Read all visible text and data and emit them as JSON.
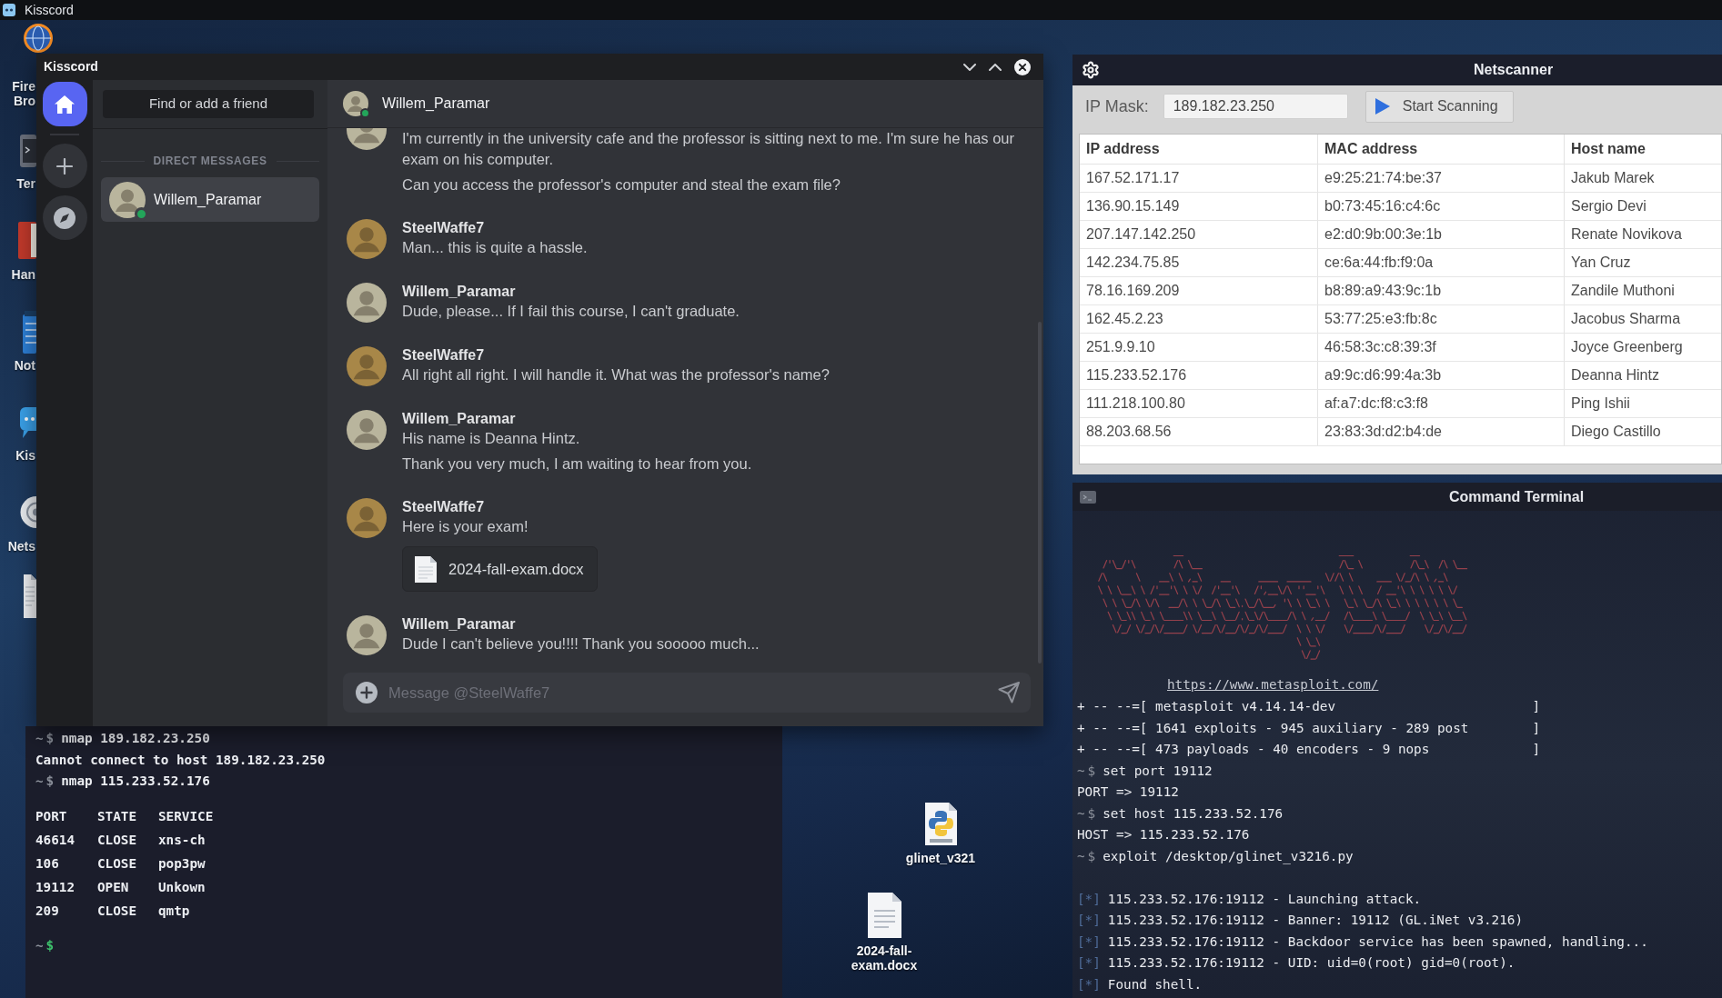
{
  "top_bar": {
    "title": "Kisscord"
  },
  "desktop_icons": [
    {
      "kind": "browser",
      "label": "Fire Bro"
    },
    {
      "kind": "terminal",
      "label": "Ter"
    },
    {
      "kind": "book",
      "label": "Han"
    },
    {
      "kind": "notes",
      "label": "Not"
    },
    {
      "kind": "chat",
      "label": "Kis"
    },
    {
      "kind": "scanner",
      "label": "Nets"
    },
    {
      "kind": "document"
    }
  ],
  "shell_terminal": {
    "lines": [
      {
        "kind": "command",
        "dir": "~",
        "symbol": "$",
        "active": false,
        "text": "nmap 189.182.23.250"
      },
      {
        "kind": "output",
        "text": "Cannot connect to host 189.182.23.250"
      },
      {
        "kind": "command",
        "dir": "~",
        "symbol": "$",
        "active": false,
        "text": "nmap 115.233.52.176"
      }
    ],
    "port_table": {
      "columns": [
        "PORT",
        "STATE",
        "SERVICE"
      ],
      "rows": [
        [
          "46614",
          "CLOSE",
          "xns-ch"
        ],
        [
          "106",
          "CLOSE",
          "pop3pw"
        ],
        [
          "19112",
          "OPEN",
          "Unkown"
        ],
        [
          "209",
          "CLOSE",
          "qmtp"
        ]
      ]
    },
    "prompt": {
      "dir": "~",
      "symbol": "$",
      "active": true
    }
  },
  "desktop_files": [
    {
      "kind": "python",
      "label": "glinet_v321"
    },
    {
      "kind": "document",
      "label": "2024-fall-exam.docx"
    }
  ],
  "kisscord": {
    "title": "Kisscord",
    "rail": [
      {
        "kind": "home",
        "selected": true
      },
      {
        "kind": "add",
        "selected": false
      },
      {
        "kind": "explore",
        "selected": false
      }
    ],
    "search_button": "Find or add a friend",
    "dm_header": "DIRECT MESSAGES",
    "direct_messages": [
      {
        "name": "Willem_Paramar",
        "online": true,
        "selected": true,
        "color": "#b9b59d"
      }
    ],
    "chat": {
      "name": "Willem_Paramar",
      "online": true,
      "color": "#b9b59d",
      "groups": [
        {
          "color": "#b9b59d",
          "messages": [
            {
              "kind": "text",
              "text": "I'm currently in the university cafe and the professor is sitting next to me. I'm sure he has our exam on his computer."
            },
            {
              "kind": "text",
              "text": "Can you access the professor's computer and steal the exam file?"
            }
          ]
        },
        {
          "author": "SteelWaffe7",
          "color": "#a88748",
          "messages": [
            {
              "kind": "text",
              "text": "Man... this is quite a hassle."
            }
          ]
        },
        {
          "author": "Willem_Paramar",
          "color": "#b9b59d",
          "messages": [
            {
              "kind": "text",
              "text": "Dude, please... If I fail this course, I can't graduate."
            }
          ]
        },
        {
          "author": "SteelWaffe7",
          "color": "#a88748",
          "messages": [
            {
              "kind": "text",
              "text": "All right all right. I will handle it. What was the professor's name?"
            }
          ]
        },
        {
          "author": "Willem_Paramar",
          "color": "#b9b59d",
          "messages": [
            {
              "kind": "text",
              "text": "His name is Deanna Hintz."
            },
            {
              "kind": "text",
              "text": "Thank you very much, I am waiting to hear from you."
            }
          ]
        },
        {
          "author": "SteelWaffe7",
          "color": "#a88748",
          "messages": [
            {
              "kind": "text",
              "text": "Here is your exam!"
            },
            {
              "kind": "file",
              "text": "2024-fall-exam.docx"
            }
          ]
        },
        {
          "author": "Willem_Paramar",
          "color": "#b9b59d",
          "messages": [
            {
              "kind": "text",
              "text": "Dude I can't believe you!!!! Thank you sooooo much..."
            }
          ]
        }
      ]
    },
    "composer": {
      "placeholder": "Message @SteelWaffe7"
    }
  },
  "netscanner": {
    "title": "Netscanner",
    "mask_label": "IP Mask:",
    "mask_value": "189.182.23.250",
    "scan_button": "Start Scanning",
    "table": {
      "columns": [
        "IP address",
        "MAC address",
        "Host name"
      ],
      "rows": [
        [
          "167.52.171.17",
          "e9:25:21:74:be:37",
          "Jakub Marek"
        ],
        [
          "136.90.15.149",
          "b0:73:45:16:c4:6c",
          "Sergio Devi"
        ],
        [
          "207.147.142.250",
          "e2:d0:9b:00:3e:1b",
          "Renate Novikova"
        ],
        [
          "142.234.75.85",
          "ce:6a:44:fb:f9:0a",
          "Yan Cruz"
        ],
        [
          "78.16.169.209",
          "b8:89:a9:43:9c:1b",
          "Zandile Muthoni"
        ],
        [
          "162.45.2.23",
          "53:77:25:e3:fb:8c",
          "Jacobus Sharma"
        ],
        [
          "251.9.9.10",
          "46:58:3c:c8:39:3f",
          "Joyce Greenberg"
        ],
        [
          "115.233.52.176",
          "a9:9c:d6:99:4a:3b",
          "Deanna Hintz"
        ],
        [
          "111.218.100.80",
          "af:a7:dc:f8:c3:f8",
          "Ping Ishii"
        ],
        [
          "88.203.68.56",
          "23:83:3d:d2:b4:de",
          "Diego Castillo"
        ]
      ]
    }
  },
  "command_terminal": {
    "title": "Command Terminal",
    "url": "https://www.metasploit.com/",
    "lines": [
      {
        "kind": "banner",
        "text": "+ -- --=[ metasploit v4.14.14-dev",
        "end": "]"
      },
      {
        "kind": "banner",
        "text": "+ -- --=[ 1641 exploits - 945 auxiliary - 289 post",
        "end": "]"
      },
      {
        "kind": "banner",
        "text": "+ -- --=[ 473 payloads - 40 encoders - 9 nops",
        "end": "]"
      },
      {
        "kind": "command",
        "dir": "~",
        "symbol": "$",
        "active": false,
        "text": "set port 19112"
      },
      {
        "kind": "output",
        "text": "PORT => 19112"
      },
      {
        "kind": "command",
        "dir": "~",
        "symbol": "$",
        "active": false,
        "text": "set host 115.233.52.176"
      },
      {
        "kind": "output",
        "text": "HOST => 115.233.52.176"
      },
      {
        "kind": "command",
        "dir": "~",
        "symbol": "$",
        "active": false,
        "text": "exploit /desktop/glinet_v3216.py"
      },
      {
        "kind": "blank"
      },
      {
        "kind": "status",
        "tag": "[*]",
        "text": "115.233.52.176:19112 - Launching attack."
      },
      {
        "kind": "status",
        "tag": "[*]",
        "text": "115.233.52.176:19112 - Banner: 19112 (GL.iNet v3.216)"
      },
      {
        "kind": "status",
        "tag": "[*]",
        "text": "115.233.52.176:19112 - Backdoor service has been spawned, handling..."
      },
      {
        "kind": "status",
        "tag": "[*]",
        "text": "115.233.52.176:19112 - UID: uid=0(root) gid=0(root)."
      },
      {
        "kind": "status",
        "tag": "[*]",
        "text": "Found shell."
      }
    ]
  }
}
